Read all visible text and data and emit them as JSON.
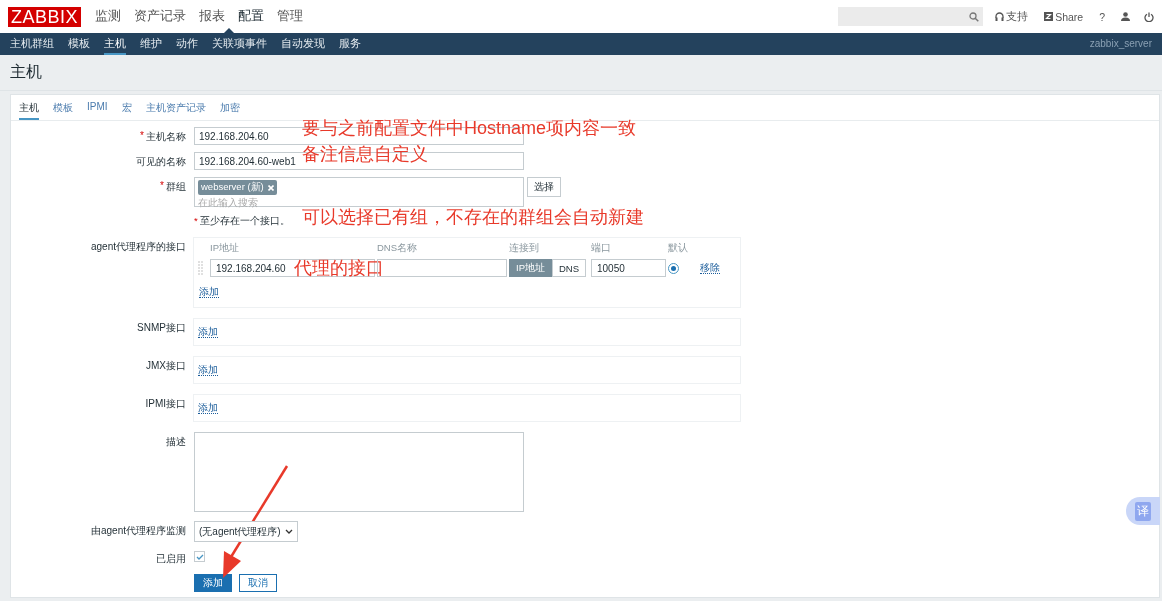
{
  "header": {
    "logo": "ZABBIX",
    "menu": [
      {
        "label": "监测",
        "selected": false
      },
      {
        "label": "资产记录",
        "selected": false
      },
      {
        "label": "报表",
        "selected": false
      },
      {
        "label": "配置",
        "selected": true
      },
      {
        "label": "管理",
        "selected": false
      }
    ],
    "links": [
      {
        "kind": "support",
        "label": "支持"
      },
      {
        "kind": "share",
        "label": "Share"
      },
      {
        "kind": "help",
        "label": "?"
      }
    ]
  },
  "submenu": {
    "items": [
      {
        "label": "主机群组",
        "selected": false
      },
      {
        "label": "模板",
        "selected": false
      },
      {
        "label": "主机",
        "selected": true
      },
      {
        "label": "维护",
        "selected": false
      },
      {
        "label": "动作",
        "selected": false
      },
      {
        "label": "关联项事件",
        "selected": false
      },
      {
        "label": "自动发现",
        "selected": false
      },
      {
        "label": "服务",
        "selected": false
      }
    ],
    "server": "zabbix_server"
  },
  "page_title": "主机",
  "tabs": [
    {
      "label": "主机",
      "selected": true
    },
    {
      "label": "模板",
      "selected": false
    },
    {
      "label": "IPMI",
      "selected": false
    },
    {
      "label": "宏",
      "selected": false
    },
    {
      "label": "主机资产记录",
      "selected": false
    },
    {
      "label": "加密",
      "selected": false
    }
  ],
  "form": {
    "host_name": {
      "mark": "*",
      "label": "主机名称",
      "value": "192.168.204.60",
      "annotation": "要与之前配置文件中Hostname项内容一致"
    },
    "visible_name": {
      "label": "可见的名称",
      "value": "192.168.204.60-web1",
      "annotation": "备注信息自定义"
    },
    "groups": {
      "mark": "*",
      "label": "群组",
      "tags": [
        {
          "label": "webserver (新)"
        }
      ],
      "placeholder": "在此输入搜索",
      "select_button": "选择",
      "annotation": "可以选择已有组，不存在的群组会自动新建"
    },
    "interface_note": {
      "mark": "*",
      "text": "至少存在一个接口。"
    },
    "interfaces": [
      {
        "label": "agent代理程序的接口",
        "columns": [
          "IP地址",
          "DNS名称",
          "连接到",
          "端口",
          "默认"
        ],
        "rows": [
          {
            "ip": "192.168.204.60",
            "annotation": "代理的接口",
            "connect": [
              {
                "label": "IP地址",
                "selected": true
              },
              {
                "label": "DNS",
                "selected": false
              }
            ],
            "port": "10050",
            "default": true,
            "remove": "移除"
          }
        ],
        "add": "添加"
      },
      {
        "label": "SNMP接口",
        "add": "添加"
      },
      {
        "label": "JMX接口",
        "add": "添加"
      },
      {
        "label": "IPMI接口",
        "add": "添加"
      }
    ],
    "description": {
      "label": "描述"
    },
    "proxy": {
      "label": "由agent代理程序监测",
      "value": "(无agent代理程序)"
    },
    "enabled": {
      "label": "已启用",
      "checked": true
    },
    "buttons": [
      {
        "label": "添加",
        "kind": "primary"
      },
      {
        "label": "取消",
        "kind": "secondary"
      }
    ]
  },
  "translate_button": {
    "label": "译"
  }
}
